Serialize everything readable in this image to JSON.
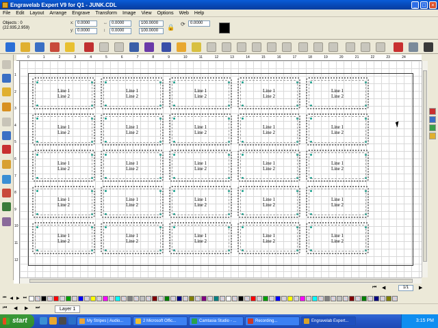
{
  "window": {
    "title": "Engravelab Expert V9 for Q1 - JUNK.CDL"
  },
  "menu": [
    "File",
    "Edit",
    "Layout",
    "Arrange",
    "Engrave",
    "Transform",
    "Image",
    "View",
    "Options",
    "Web",
    "Help"
  ],
  "properties": {
    "objects_label": "Objects : 0",
    "cursor_pos": "(22.935,2.959)",
    "x_value": "0.0000",
    "y_value": "0.0000",
    "w_value": "0.0000",
    "h_value": "0.0000",
    "sx_value": "100.0000",
    "sy_value": "100.0000",
    "rotation_value": "0.0000"
  },
  "ruler_top": [
    "0",
    "1",
    "2",
    "3",
    "4",
    "5",
    "6",
    "7",
    "8",
    "9",
    "10",
    "11",
    "12",
    "13",
    "14",
    "15",
    "16",
    "17",
    "18",
    "19",
    "20",
    "21",
    "22",
    "23",
    "24"
  ],
  "ruler_left": [
    "1",
    "2",
    "3",
    "4",
    "5",
    "6",
    "7",
    "8",
    "9",
    "10",
    "11",
    "12"
  ],
  "tags": {
    "line1": "Line 1",
    "line2": "Line 2",
    "rows": 5,
    "cols": 5
  },
  "page_nav": {
    "page": "1/1"
  },
  "layer": {
    "name": "Layer 1"
  },
  "taskbar": {
    "start": "start",
    "items": [
      {
        "label": "My Stripes | Audio...",
        "color": "#e8a43a"
      },
      {
        "label": "2 Microsoft Offic...",
        "color": "#f0c030"
      },
      {
        "label": "Camtasia Studio - ...",
        "color": "#2aa24c"
      },
      {
        "label": "Recording...",
        "color": "#c83a2a"
      },
      {
        "label": "Engravelab Expert...",
        "color": "#d9a32a"
      }
    ],
    "clock": "3:15 PM"
  },
  "colors": {
    "accent": "#0a5cd8",
    "tag_corner": "#18a08c"
  }
}
